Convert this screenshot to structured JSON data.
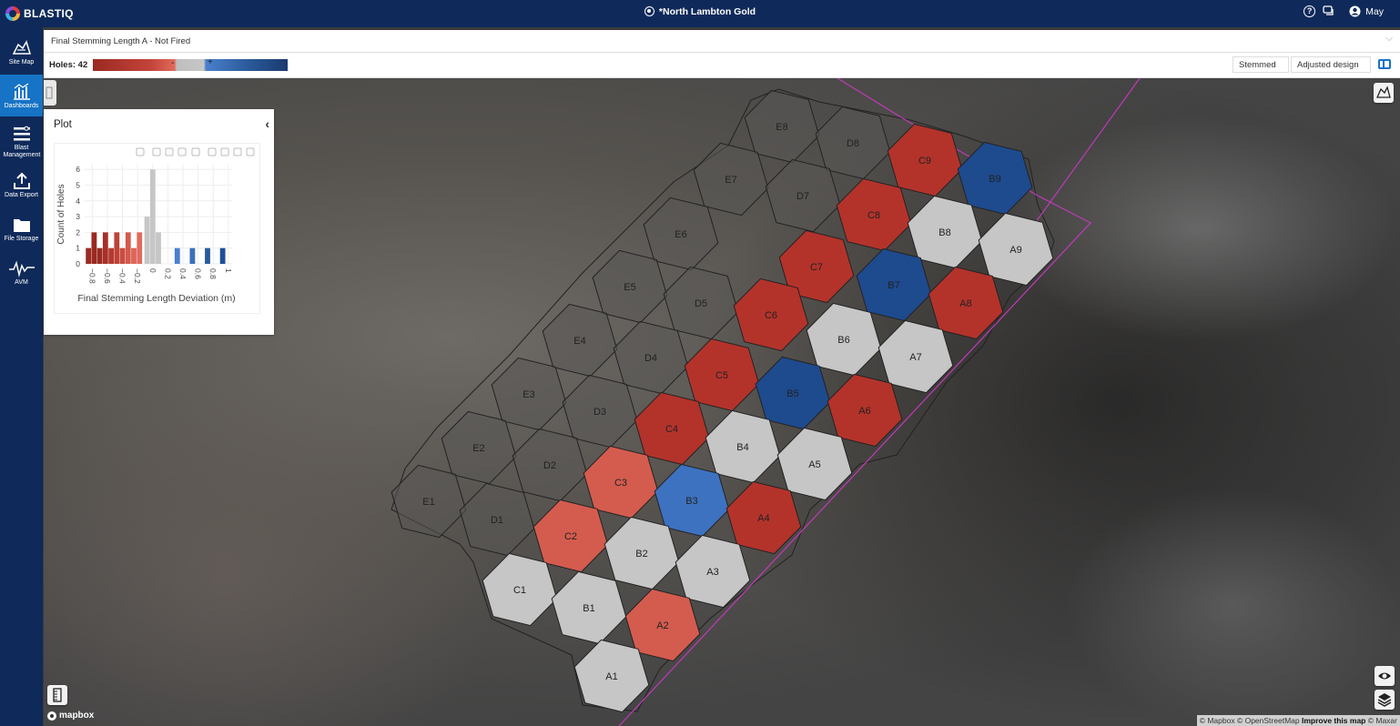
{
  "app": {
    "name": "BLASTIQ"
  },
  "header": {
    "site": "*North Lambton Gold",
    "help_icon": "help-icon",
    "chat_icon": "chat-icon",
    "user": "May"
  },
  "sidebar": {
    "items": [
      {
        "label": "Site Map",
        "icon": "site-map-icon",
        "active": false
      },
      {
        "label": "Dashboards",
        "icon": "dashboards-icon",
        "active": true
      },
      {
        "label": "Blast Management",
        "icon": "blast-management-icon",
        "active": false
      },
      {
        "label": "Data Export",
        "icon": "data-export-icon",
        "active": false
      },
      {
        "label": "File Storage",
        "icon": "file-storage-icon",
        "active": false
      },
      {
        "label": "AVM",
        "icon": "avm-icon",
        "active": false
      }
    ]
  },
  "filter": {
    "value": "Final Stemming Length A - Not Fired"
  },
  "legend": {
    "holes_label": "Holes: 42",
    "minus": "-",
    "plus": "+",
    "colors": {
      "neg_dark": "#9a2a22",
      "neg": "#c4443a",
      "neg_light": "#e06a5c",
      "neutral": "#c6c6c6",
      "pos_light": "#3f78c8",
      "pos": "#1f4f96"
    }
  },
  "controls": {
    "stemmed": "Stemmed",
    "design": "Adjusted design"
  },
  "panel": {
    "title": "Plot",
    "toolbar_icons": [
      "camera-icon",
      "zoom-icon",
      "pan-icon",
      "box-select-icon",
      "lasso-icon",
      "zoom-in-icon",
      "zoom-out-icon",
      "autoscale-icon",
      "home-icon"
    ]
  },
  "chart_data": {
    "type": "bar",
    "xlabel": "Final Stemming Length Deviation (m)",
    "ylabel": "Count of Holes",
    "ylim": [
      0,
      6.3
    ],
    "xlim": [
      -0.9,
      1.05
    ],
    "x_ticks": [
      "−0.8",
      "−0.6",
      "−0.4",
      "−0.2",
      "0",
      "0.2",
      "0.4",
      "0.6",
      "0.8",
      "1"
    ],
    "y_ticks": [
      "0",
      "1",
      "2",
      "3",
      "4",
      "5",
      "6"
    ],
    "grid": true,
    "bars": [
      {
        "x": -0.85,
        "y": 1,
        "color": "#9a2a22"
      },
      {
        "x": -0.775,
        "y": 2,
        "color": "#9a2a22"
      },
      {
        "x": -0.7,
        "y": 1,
        "color": "#9a2a22"
      },
      {
        "x": -0.625,
        "y": 2,
        "color": "#a83028"
      },
      {
        "x": -0.55,
        "y": 1,
        "color": "#b33a30"
      },
      {
        "x": -0.475,
        "y": 2,
        "color": "#be4237"
      },
      {
        "x": -0.4,
        "y": 1,
        "color": "#c84c40"
      },
      {
        "x": -0.325,
        "y": 2,
        "color": "#d35a4c"
      },
      {
        "x": -0.25,
        "y": 1,
        "color": "#dd6658"
      },
      {
        "x": -0.175,
        "y": 2,
        "color": "#e06a5c"
      },
      {
        "x": -0.075,
        "y": 3,
        "color": "#c6c6c6"
      },
      {
        "x": 0.0,
        "y": 6,
        "color": "#c6c6c6"
      },
      {
        "x": 0.075,
        "y": 2,
        "color": "#c6c6c6"
      },
      {
        "x": 0.325,
        "y": 1,
        "color": "#4a80cc"
      },
      {
        "x": 0.525,
        "y": 1,
        "color": "#3a6fb8"
      },
      {
        "x": 0.725,
        "y": 1,
        "color": "#2a5a9a"
      },
      {
        "x": 0.925,
        "y": 1,
        "color": "#1f4f96"
      }
    ]
  },
  "holes": [
    {
      "label": "E8",
      "status": "unknown"
    },
    {
      "label": "D8",
      "status": "unknown"
    },
    {
      "label": "C9",
      "status": "neg"
    },
    {
      "label": "B9",
      "status": "pos"
    },
    {
      "label": "E7",
      "status": "unknown"
    },
    {
      "label": "D7",
      "status": "unknown"
    },
    {
      "label": "C8",
      "status": "neg"
    },
    {
      "label": "B8",
      "status": "neutral"
    },
    {
      "label": "A9",
      "status": "neutral"
    },
    {
      "label": "E6",
      "status": "unknown"
    },
    {
      "label": "C7",
      "status": "neg"
    },
    {
      "label": "B7",
      "status": "pos"
    },
    {
      "label": "A8",
      "status": "neg"
    },
    {
      "label": "E5",
      "status": "unknown"
    },
    {
      "label": "D5",
      "status": "unknown"
    },
    {
      "label": "C6",
      "status": "neg"
    },
    {
      "label": "B6",
      "status": "neutral"
    },
    {
      "label": "A7",
      "status": "neutral"
    },
    {
      "label": "E4",
      "status": "unknown"
    },
    {
      "label": "D4",
      "status": "unknown"
    },
    {
      "label": "C5",
      "status": "neg"
    },
    {
      "label": "B5",
      "status": "pos"
    },
    {
      "label": "A6",
      "status": "neg"
    },
    {
      "label": "E3",
      "status": "unknown"
    },
    {
      "label": "D3",
      "status": "unknown"
    },
    {
      "label": "C4",
      "status": "neg"
    },
    {
      "label": "B4",
      "status": "neutral"
    },
    {
      "label": "A5",
      "status": "neutral"
    },
    {
      "label": "E2",
      "status": "unknown"
    },
    {
      "label": "D2",
      "status": "unknown"
    },
    {
      "label": "C3",
      "status": "neg_light"
    },
    {
      "label": "B3",
      "status": "pos_light"
    },
    {
      "label": "A4",
      "status": "neg"
    },
    {
      "label": "E1",
      "status": "unknown"
    },
    {
      "label": "D1",
      "status": "unknown"
    },
    {
      "label": "C2",
      "status": "neg_light"
    },
    {
      "label": "B2",
      "status": "neutral"
    },
    {
      "label": "A3",
      "status": "neutral"
    },
    {
      "label": "C1",
      "status": "neutral"
    },
    {
      "label": "B1",
      "status": "neutral"
    },
    {
      "label": "A2",
      "status": "neg_light"
    },
    {
      "label": "A1",
      "status": "neutral"
    }
  ],
  "map": {
    "mapbox_label": "mapbox",
    "attribution": {
      "mapbox": "© Mapbox",
      "osm": "© OpenStreetMap",
      "improve": "Improve this map",
      "maxar": "© Maxar"
    },
    "eye_icon": "eye-icon",
    "layers_icon": "layers-icon",
    "ruler_icon": "ruler-icon",
    "map_style_icon": "map-style-icon"
  }
}
